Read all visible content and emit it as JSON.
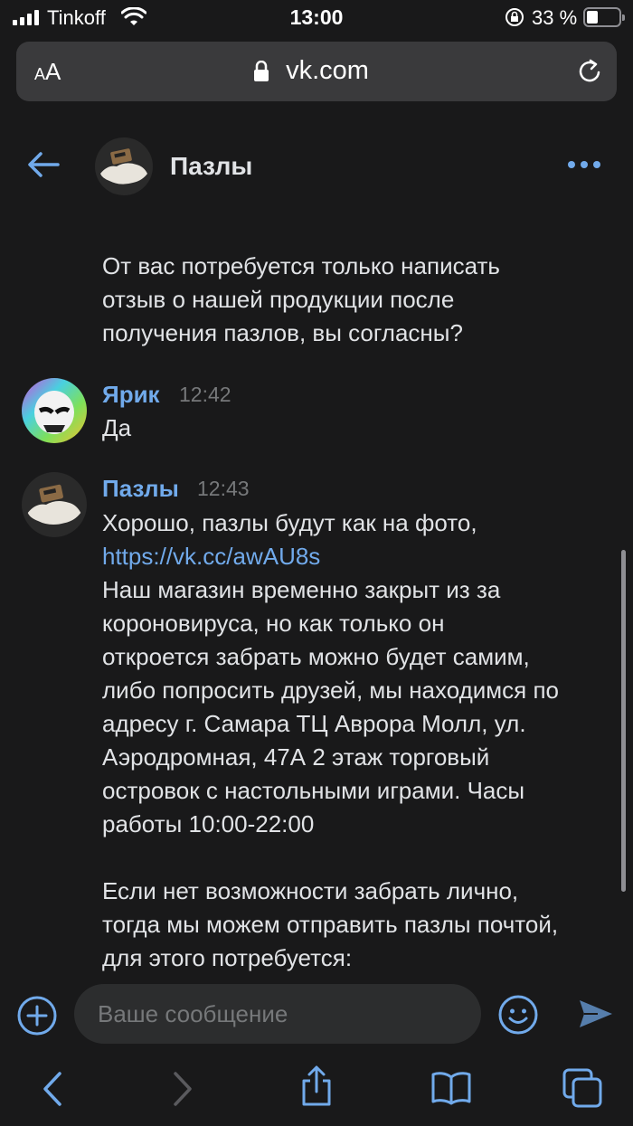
{
  "status_bar": {
    "carrier": "Tinkoff",
    "time": "13:00",
    "battery": "33 %",
    "battery_level": 0.33
  },
  "browser": {
    "text_size_label": "AA",
    "url": "vk.com"
  },
  "chat": {
    "title": "Пазлы"
  },
  "messages": [
    {
      "author": "",
      "time": "",
      "lines": [
        "От вас потребуется только написать",
        "отзыв о нашей продукции после",
        "получения пазлов, вы согласны?"
      ]
    },
    {
      "author": "Ярик",
      "time": "12:42",
      "lines": [
        "Да"
      ]
    },
    {
      "author": "Пазлы",
      "time": "12:43",
      "line_intro": "Хорошо, пазлы будут как на фото,",
      "link": "https://vk.cc/awAU8s",
      "lines": [
        "Наш магазин временно закрыт из за",
        "короновируса, но как только он",
        "откроется забрать можно будет самим,",
        "либо попросить друзей, мы находимся по",
        "адресу г. Самара ТЦ Аврора Молл, ул.",
        "Аэродромная, 47А 2 этаж торговый",
        "островок с настольными играми. Часы",
        "работы 10:00-22:00"
      ],
      "lines_after": [
        "Если нет возможности забрать лично,",
        "тогда мы можем отправить пазлы почтой,",
        "для этого потребуется:"
      ]
    }
  ],
  "composer": {
    "placeholder": "Ваше сообщение"
  },
  "colors": {
    "background": "#19191a",
    "accent": "#71aaeb",
    "text": "#e1e3e6",
    "muted": "#76787a"
  }
}
